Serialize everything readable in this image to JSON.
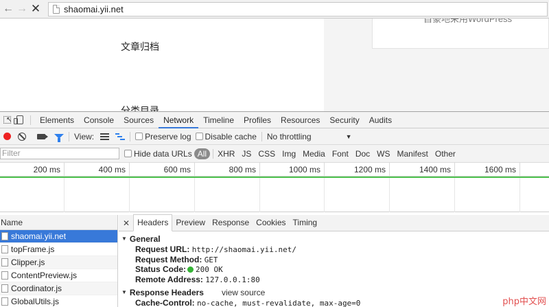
{
  "browser": {
    "url": "shaomai.yii.net"
  },
  "page": {
    "heading_archive": "文章归档",
    "heading_category": "分类目录",
    "right_card_text": "自豪地采用WordPress"
  },
  "devtools": {
    "tabs": [
      "Elements",
      "Console",
      "Sources",
      "Network",
      "Timeline",
      "Profiles",
      "Resources",
      "Security",
      "Audits"
    ],
    "active_tab": "Network",
    "toolbar": {
      "view_label": "View:",
      "preserve_log": "Preserve log",
      "disable_cache": "Disable cache",
      "throttling": "No throttling"
    },
    "filter": {
      "placeholder": "Filter",
      "hide_data_urls": "Hide data URLs",
      "types": [
        "All",
        "XHR",
        "JS",
        "CSS",
        "Img",
        "Media",
        "Font",
        "Doc",
        "WS",
        "Manifest",
        "Other"
      ]
    },
    "timeline_ticks": [
      "200 ms",
      "400 ms",
      "600 ms",
      "800 ms",
      "1000 ms",
      "1200 ms",
      "1400 ms",
      "1600 ms"
    ],
    "name_header": "Name",
    "requests": [
      "shaomai.yii.net",
      "topFrame.js",
      "Clipper.js",
      "ContentPreview.js",
      "Coordinator.js",
      "GlobalUtils.js"
    ],
    "selected_request": "shaomai.yii.net",
    "detail_tabs": [
      "Headers",
      "Preview",
      "Response",
      "Cookies",
      "Timing"
    ],
    "general": {
      "title": "General",
      "request_url_key": "Request URL:",
      "request_url": "http://shaomai.yii.net/",
      "request_method_key": "Request Method:",
      "request_method": "GET",
      "status_code_key": "Status Code:",
      "status_code": "200 OK",
      "remote_address_key": "Remote Address:",
      "remote_address": "127.0.0.1:80"
    },
    "response_headers": {
      "title": "Response Headers",
      "view_source": "view source",
      "cache_control_key": "Cache-Control:",
      "cache_control": "no-cache, must-revalidate, max-age=0"
    }
  },
  "watermark": "php中文网",
  "colors": {
    "accent": "#3879d9",
    "record": "#e22222",
    "status_ok": "#35b335",
    "overview_line": "#4bc04b"
  }
}
